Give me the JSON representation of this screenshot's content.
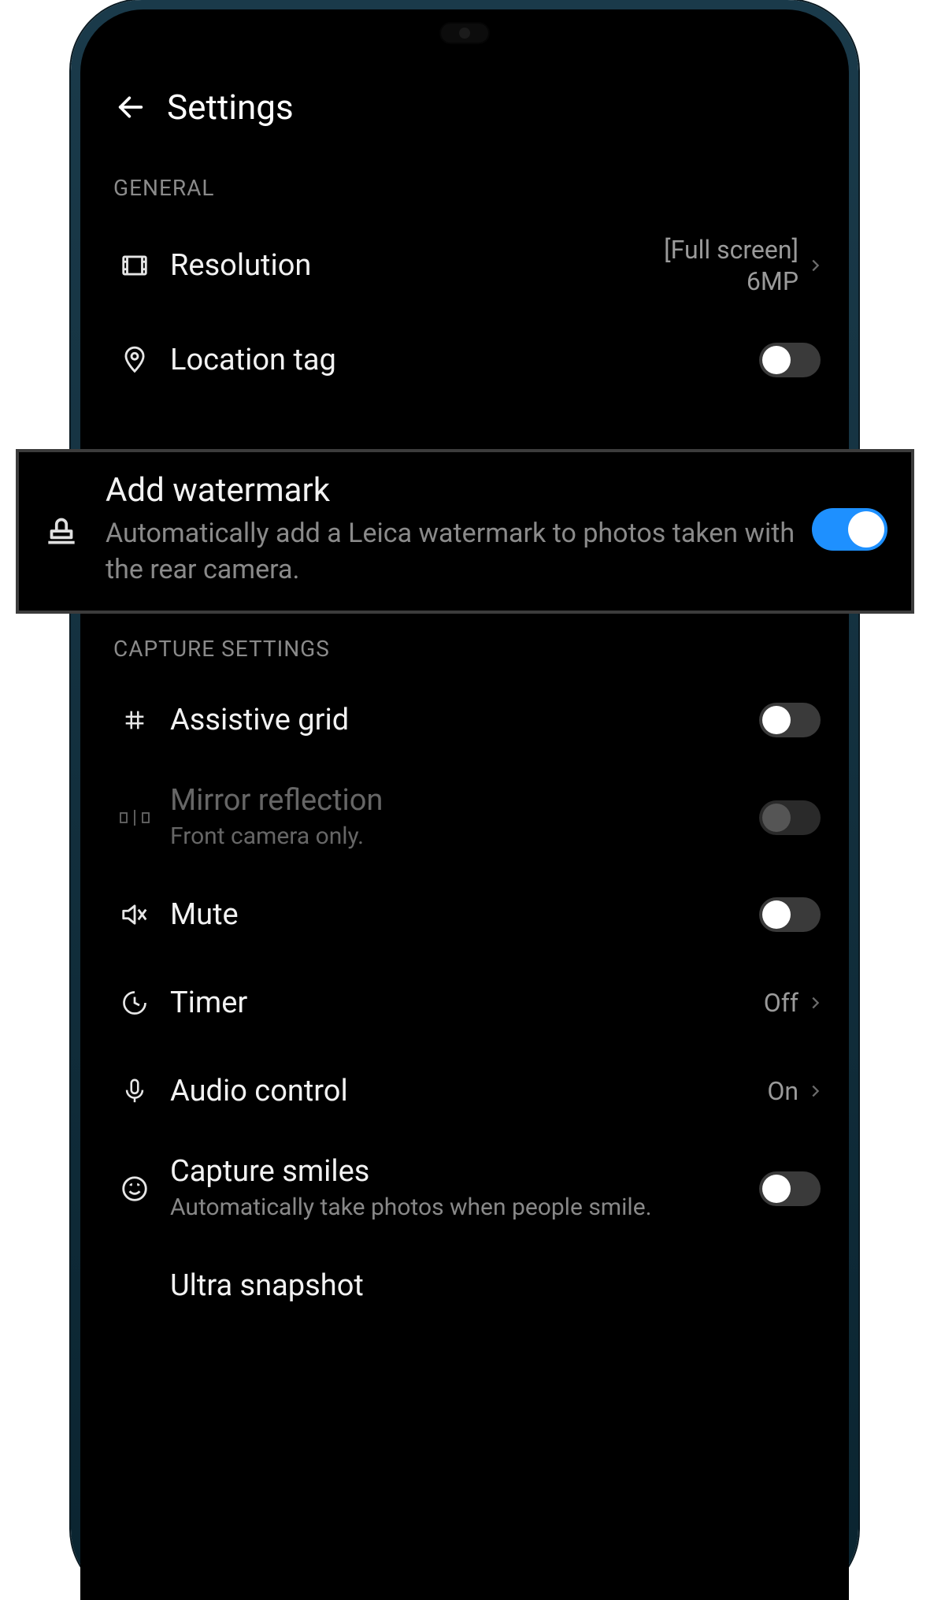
{
  "header": {
    "title": "Settings"
  },
  "sections": {
    "general_label": "GENERAL",
    "capture_label": "CAPTURE SETTINGS"
  },
  "general": {
    "resolution": {
      "label": "Resolution",
      "value_line1": "[Full screen]",
      "value_line2": "6MP"
    },
    "location_tag": {
      "label": "Location tag",
      "on": false
    },
    "add_watermark": {
      "label": "Add watermark",
      "sub": "Automatically add a Leica watermark to photos taken with the rear camera.",
      "on": true
    }
  },
  "capture": {
    "assistive_grid": {
      "label": "Assistive grid",
      "on": false
    },
    "mirror_reflection": {
      "label": "Mirror reflection",
      "sub": "Front camera only.",
      "on": false,
      "disabled": true
    },
    "mute": {
      "label": "Mute",
      "on": false
    },
    "timer": {
      "label": "Timer",
      "value": "Off"
    },
    "audio_control": {
      "label": "Audio control",
      "value": "On"
    },
    "capture_smiles": {
      "label": "Capture smiles",
      "sub": "Automatically take photos when people smile.",
      "on": false
    },
    "ultra_snapshot": {
      "label": "Ultra snapshot"
    }
  },
  "colors": {
    "accent": "#1e90ff"
  }
}
